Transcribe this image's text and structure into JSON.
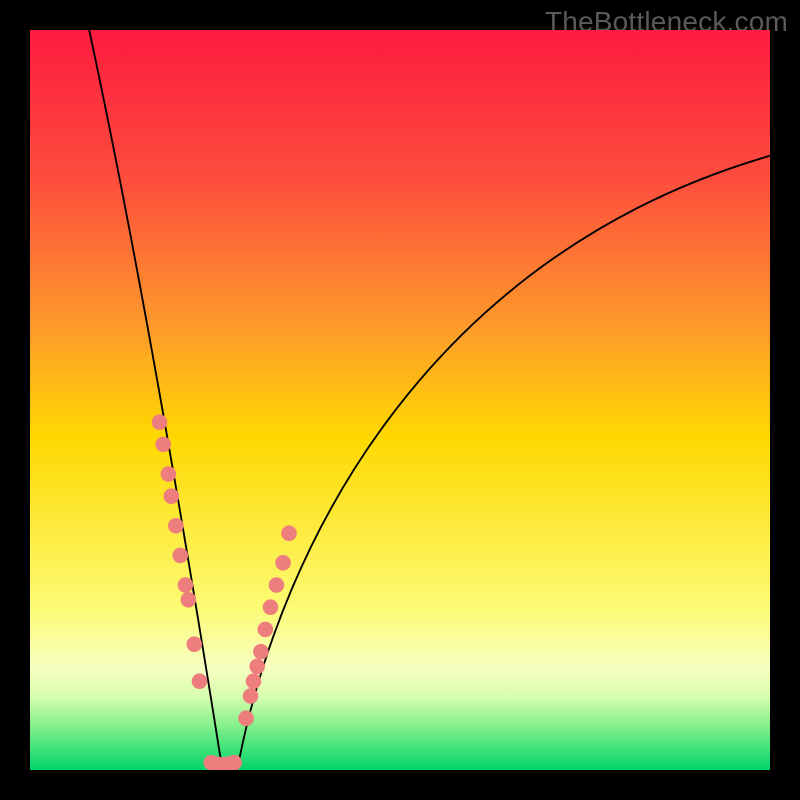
{
  "watermark": {
    "text": "TheBottleneck.com"
  },
  "chart_data": {
    "type": "line",
    "title": "",
    "xlabel": "",
    "ylabel": "",
    "xlim": [
      0,
      100
    ],
    "ylim": [
      0,
      100
    ],
    "background_gradient": {
      "stops": [
        {
          "offset": 0.0,
          "color": "#fd1b3f"
        },
        {
          "offset": 0.5,
          "color": "#fed800"
        },
        {
          "offset": 0.88,
          "color": "#f7ffb6"
        },
        {
          "offset": 0.95,
          "color": "#85f08a"
        },
        {
          "offset": 1.0,
          "color": "#00d46a"
        }
      ]
    },
    "series": [
      {
        "name": "left-curve",
        "type": "line",
        "color": "#000000",
        "x": [
          8,
          10,
          12,
          14,
          16,
          17,
          18,
          19,
          20,
          21,
          22,
          23,
          24,
          25,
          26
        ],
        "y": [
          100,
          88,
          76,
          65,
          55,
          50,
          44,
          38,
          33,
          27,
          21,
          16,
          10,
          5,
          0
        ]
      },
      {
        "name": "right-curve",
        "type": "line",
        "color": "#000000",
        "x": [
          28,
          30,
          32,
          34,
          36,
          40,
          45,
          50,
          55,
          60,
          65,
          70,
          75,
          80,
          85,
          90,
          95,
          100
        ],
        "y": [
          0,
          7,
          14,
          20,
          25,
          34,
          43,
          50,
          56,
          61,
          65,
          69,
          72,
          75,
          77.5,
          79.5,
          81.5,
          83
        ]
      }
    ],
    "markers": [
      {
        "name": "left-dots",
        "color": "#f07070",
        "x": [
          17.5,
          18.0,
          18.7,
          19.1,
          19.7,
          20.3,
          21.0,
          21.4,
          22.2,
          22.9
        ],
        "y": [
          47,
          44,
          40,
          37,
          33,
          29,
          25,
          23,
          17,
          12
        ]
      },
      {
        "name": "right-dots",
        "color": "#f07070",
        "x": [
          29.2,
          29.8,
          30.2,
          30.7,
          31.2,
          31.8,
          32.5,
          33.3,
          34.2,
          35.0
        ],
        "y": [
          7,
          10,
          12,
          14,
          16,
          19,
          22,
          25,
          28,
          32
        ]
      },
      {
        "name": "bottom-dots",
        "color": "#f07070",
        "x": [
          24.5,
          25.2,
          26.0,
          26.8,
          27.6
        ],
        "y": [
          0.8,
          0.6,
          0.5,
          0.6,
          0.8
        ]
      }
    ]
  }
}
